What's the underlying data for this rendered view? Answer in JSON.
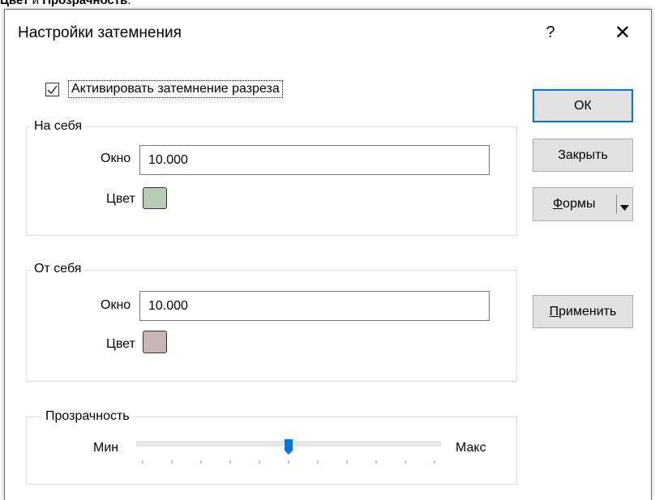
{
  "doc_text": {
    "part1": "Цвет",
    "part2": " и ",
    "part3": "Прозрачность",
    "part4": "."
  },
  "dialog": {
    "title": "Настройки затемнения",
    "help_label": "?",
    "close_label": "✕"
  },
  "activate": {
    "checked": true,
    "label": "Активировать затемнение разреза"
  },
  "near": {
    "legend": "На себя",
    "window_label": "Окно",
    "window_value": "10.000",
    "color_label": "Цвет",
    "color": "#b8cbb4"
  },
  "far": {
    "legend": "От себя",
    "window_label": "Окно",
    "window_value": "10.000",
    "color_label": "Цвет",
    "color": "#c8b6b6"
  },
  "transparency": {
    "legend": "Прозрачность",
    "min_label": "Мин",
    "max_label": "Макс",
    "value_percent": 50,
    "tick_count": 11
  },
  "buttons": {
    "ok": "ОК",
    "close": "Закрыть",
    "forms": "Формы",
    "apply": "Применить"
  },
  "colors": {
    "accent": "#0078d7"
  }
}
